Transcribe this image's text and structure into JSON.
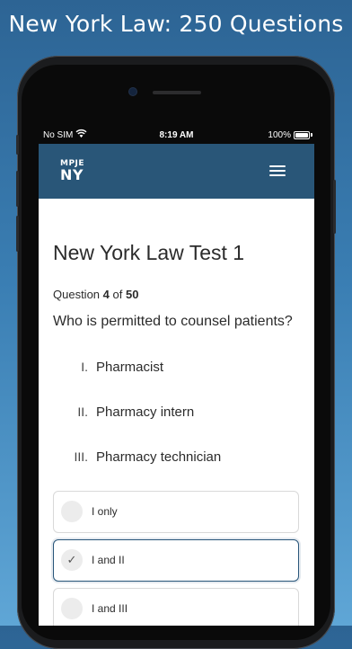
{
  "headline": "New York Law: 250 Questions",
  "status_bar": {
    "carrier": "No SIM",
    "time": "8:19 AM",
    "battery": "100%"
  },
  "nav": {
    "logo_line1": "MPJE",
    "logo_line2": "NY",
    "menu_icon": "hamburger-menu-icon"
  },
  "test": {
    "title": "New York Law Test 1",
    "question_label": "Question",
    "question_current": "4",
    "question_of": "of",
    "question_total": "50",
    "question_text": "Who is permitted to counsel patients?",
    "statements": [
      {
        "num": "I.",
        "text": "Pharmacist"
      },
      {
        "num": "II.",
        "text": "Pharmacy intern"
      },
      {
        "num": "III.",
        "text": "Pharmacy technician"
      }
    ],
    "options": [
      {
        "label": "I only",
        "selected": false
      },
      {
        "label": "I and II",
        "selected": true,
        "icon": "check-icon"
      },
      {
        "label": "I and III",
        "selected": false
      }
    ]
  },
  "colors": {
    "navbar": "#295678",
    "selected_border": "#29567a",
    "background_top": "#2d6494",
    "background_bottom": "#5fa6d6"
  }
}
